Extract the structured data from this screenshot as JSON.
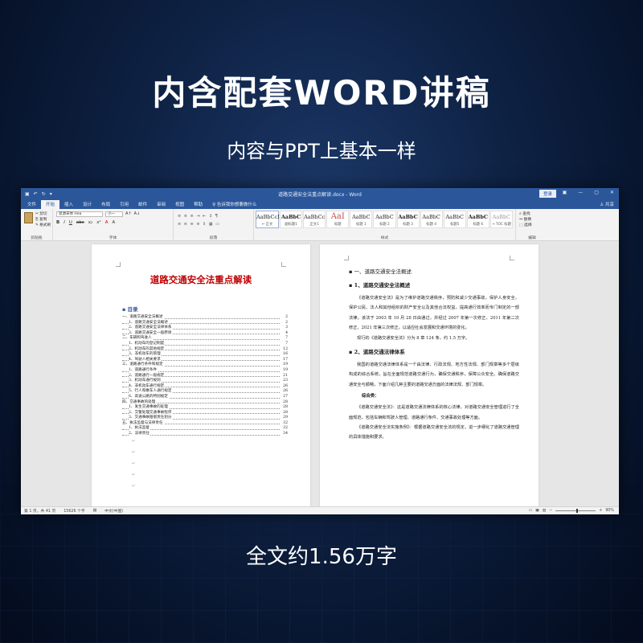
{
  "headline": "内含配套WORD讲稿",
  "subhead": "内容与PPT上基本一样",
  "footer_note": "全文约1.56万字",
  "word": {
    "title": "道路交通安全法重点解读.docx - Word",
    "login": "登录",
    "share": "♙ 共享",
    "tabs": [
      "文件",
      "开始",
      "插入",
      "设计",
      "布局",
      "引用",
      "邮件",
      "审阅",
      "视图",
      "帮助",
      "♀ 告诉我你想要做什么"
    ],
    "active_tab": "开始",
    "clipboard": {
      "label": "剪贴板",
      "items": [
        "✂ 剪切",
        "⎘ 复制",
        "✎ 格式刷"
      ],
      "paste": "粘贴"
    },
    "font": {
      "label": "字体",
      "name": "思源宋体 Hea",
      "size": "小一",
      "buttons": [
        "B",
        "I",
        "U",
        "abc",
        "x₂",
        "x²",
        "A",
        "A"
      ]
    },
    "paragraph": {
      "label": "段落",
      "rows": [
        "≡ ≡ ≡ ⇥ ⇤ ↕ ¶",
        "≡ ≡ ≡ ≡ ⇕ ▦ ▭"
      ]
    },
    "styles": {
      "label": "样式",
      "items": [
        {
          "sample": "AaBbCcI",
          "name": "↵ 正文"
        },
        {
          "sample": "AaBbC",
          "name": "副标题1"
        },
        {
          "sample": "AaBbCc",
          "name": "正文1"
        },
        {
          "sample": "AaI",
          "name": "标题"
        },
        {
          "sample": "AaBbC",
          "name": "标题 1"
        },
        {
          "sample": "AaBbC",
          "name": "标题 2"
        },
        {
          "sample": "AaBbC",
          "name": "标题 3"
        },
        {
          "sample": "AaBbC",
          "name": "标题 4"
        },
        {
          "sample": "AaBbC",
          "name": "标题5"
        },
        {
          "sample": "AaBbC",
          "name": "标题 6"
        },
        {
          "sample": "AaBbC",
          "name": "→ TOC 标题"
        }
      ]
    },
    "editing": {
      "label": "编辑",
      "items": [
        "⌕ 查找",
        "↔ 替换",
        "⬚ 选择"
      ]
    },
    "status": {
      "pages": "第 1 页，共 41 页",
      "words": "15626 个字",
      "lang": "中文(中国)",
      "zoom": "90%"
    }
  },
  "left_page": {
    "title": "道路交通安全法重点解读",
    "toc_heading": "目录",
    "toc": [
      {
        "text": "一、道路交通安全法概述",
        "page": "2",
        "level": 1
      },
      {
        "text": "1、道路交通安全法概述",
        "page": "2",
        "level": 2
      },
      {
        "text": "2、道路交通安全法律体系",
        "page": "3",
        "level": 2
      },
      {
        "text": "3、道路交通安全一般原则",
        "page": "4",
        "level": 2
      },
      {
        "text": "二、车辆和驾驶人",
        "page": "7",
        "level": 1
      },
      {
        "text": "1、机动车的登记制度",
        "page": "7",
        "level": 2
      },
      {
        "text": "2、机动车的其他规定",
        "page": "12",
        "level": 2
      },
      {
        "text": "3、非机动车的管理",
        "page": "16",
        "level": 2
      },
      {
        "text": "4、驾驶人相关要求",
        "page": "17",
        "level": 2
      },
      {
        "text": "三、道路通行条件和规定",
        "page": "19",
        "level": 1
      },
      {
        "text": "1、道路通行条件",
        "page": "19",
        "level": 2
      },
      {
        "text": "2、道路通行一般规定",
        "page": "21",
        "level": 2
      },
      {
        "text": "3、机动车通行规则",
        "page": "23",
        "level": 2
      },
      {
        "text": "4、非机动车通行规定",
        "page": "26",
        "level": 2
      },
      {
        "text": "5、行人和乘车人通行规定",
        "page": "26",
        "level": 2
      },
      {
        "text": "6、高速公路的特别规定",
        "page": "27",
        "level": 2
      },
      {
        "text": "四、交通事故的处理",
        "page": "28",
        "level": 1
      },
      {
        "text": "1、发生交通事故的处理",
        "page": "28",
        "level": 2
      },
      {
        "text": "2、交警处理交通事故程序",
        "page": "28",
        "level": 2
      },
      {
        "text": "3、交通事故赔偿责任划分",
        "page": "29",
        "level": 2
      },
      {
        "text": "五、执法监督与法律责任",
        "page": "32",
        "level": 1
      },
      {
        "text": "1、执法监督",
        "page": "32",
        "level": 2
      },
      {
        "text": "2、法律责任",
        "page": "34",
        "level": 2
      }
    ]
  },
  "right_page": {
    "h1": "一、道路交通安全法概述",
    "s1_title": "1、道路交通安全法概述",
    "s1_p1": "《道路交通安全法》是为了维护道路交通秩序，预防和减少交通事故，保护人身安全，保护公民、法人和其他组织的财产安全以及其他合法权益，提高通行效率而专门制定的一部法律。该法于 2003 年 10 月 28 日由通过，并经过 2007 年第一次修正、2011 年第二次修正、2021 年第三次修正，以适应社会发展和交通环境的变化。",
    "s1_p2": "现行的《道路交通安全法》分为 8 章 124 条，约 1.5 万字。",
    "s2_title": "2、道路交通法律体系",
    "s2_p1": "我国的道路交通法律体系是一个由法律、行政法规、地方性法规、部门规章等多个层级构成的综合系统，旨在全面规范道路交通行为，确保交通秩序，保障公众安全。确保道路交通安全与顺畅，下面介绍几种主要的道路交通方面的法律法规、部门规章。",
    "s2_b": "综合类：",
    "s2_p2": "《道路交通安全法》：这是道路交通法律体系的核心法律，对道路交通安全管理进行了全面规范，包括车辆和驾驶人管理、道路通行条件、交通事故处理等方面。",
    "s2_p3": "《道路交通安全法实施条例》：根据道路交通安全法的规定，进一步细化了道路交通管理的具体措施和要求。"
  }
}
